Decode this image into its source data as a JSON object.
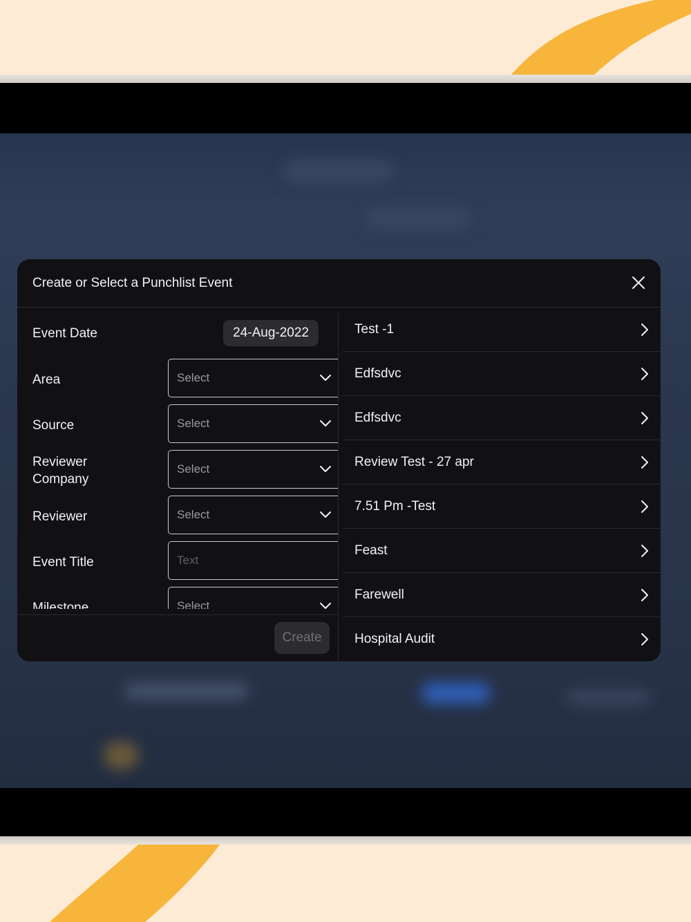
{
  "modal": {
    "title": "Create or Select a Punchlist Event",
    "close_icon": "close-icon"
  },
  "form": {
    "event_date": {
      "label": "Event Date",
      "value": "24-Aug-2022"
    },
    "area": {
      "label": "Area",
      "placeholder": "Select"
    },
    "source": {
      "label": "Source",
      "placeholder": "Select"
    },
    "reviewer_company": {
      "label_line1": "Reviewer",
      "label_line2": "Company",
      "placeholder": "Select"
    },
    "reviewer": {
      "label": "Reviewer",
      "placeholder": "Select"
    },
    "event_title": {
      "label": "Event Title",
      "placeholder": "Text"
    },
    "milestone": {
      "label": "Milestone",
      "placeholder": "Select"
    },
    "create_label": "Create"
  },
  "events": [
    {
      "name": "Test -1"
    },
    {
      "name": "Edfsdvc"
    },
    {
      "name": "Edfsdvc"
    },
    {
      "name": "Review Test - 27 apr"
    },
    {
      "name": "7.51 Pm -Test"
    },
    {
      "name": "Feast"
    },
    {
      "name": "Farewell"
    },
    {
      "name": "Hospital Audit"
    }
  ],
  "colors": {
    "modal_bg": "#111114",
    "page_bg": "#fdebd6",
    "accent_swoosh": "#f7b53b"
  }
}
